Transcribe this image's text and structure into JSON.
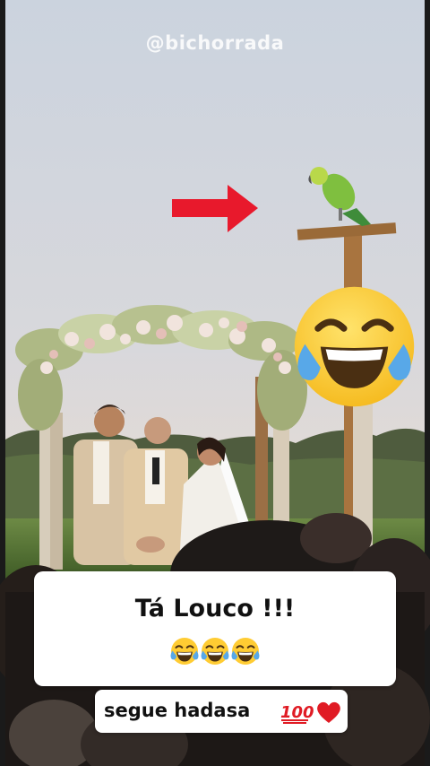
{
  "watermark": "@bichorrada",
  "caption": {
    "title": "Tá Louco !!!",
    "emoji_count": 3,
    "emoji_icon": "tears-of-joy-icon"
  },
  "follow": {
    "text": "segue hadasa",
    "icons": [
      "hundred-points-icon",
      "red-heart-icon"
    ]
  },
  "overlay_icons": [
    "red-arrow-icon",
    "tears-of-joy-icon"
  ],
  "colors": {
    "arrow": "#e8192c",
    "emoji_face": "#ffcc33",
    "tears": "#58a8e8",
    "caption_bg": "#ffffff"
  }
}
